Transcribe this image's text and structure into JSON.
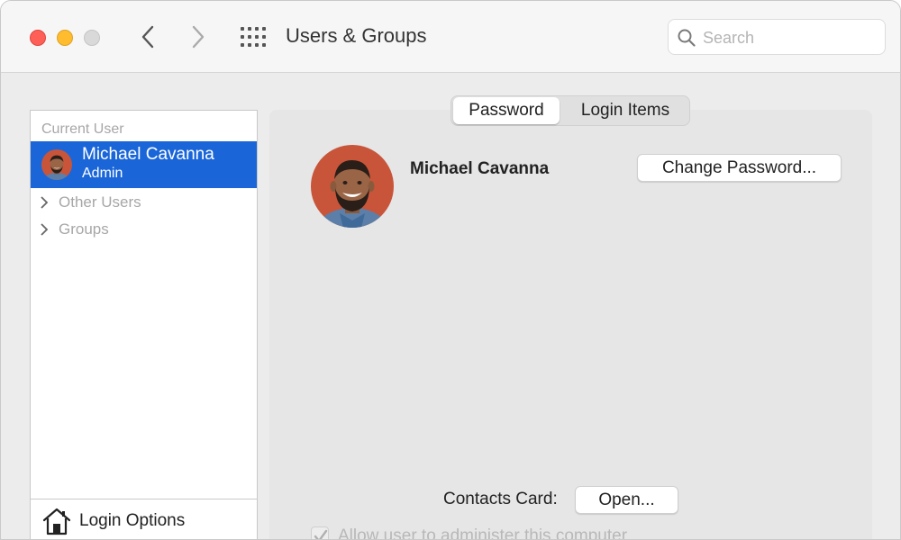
{
  "window": {
    "title": "Users & Groups"
  },
  "toolbar": {
    "search": {
      "placeholder": "Search",
      "value": ""
    },
    "icons": [
      "close-button",
      "minimize-button",
      "zoom-button",
      "back-chevron-icon",
      "forward-chevron-icon",
      "grid-icon",
      "search-icon"
    ]
  },
  "sidebar": {
    "section_label": "Current User",
    "current_user": {
      "name": "Michael Cavanna",
      "role": "Admin"
    },
    "groups": [
      {
        "label": "Other Users"
      },
      {
        "label": "Groups"
      }
    ],
    "login_options_label": "Login Options"
  },
  "tabs": [
    {
      "label": "Password",
      "selected": true
    },
    {
      "label": "Login Items",
      "selected": false
    }
  ],
  "main": {
    "user_name": "Michael Cavanna",
    "change_password_label": "Change Password...",
    "contacts_card_label": "Contacts Card:",
    "open_button_label": "Open...",
    "allow_admin_label": "Allow user to administer this computer",
    "allow_admin_checked": true
  },
  "colors": {
    "selection": "#1a66d9",
    "close": "#fe5f57",
    "minimize": "#febc2e",
    "zoom_disabled": "#d9d9d9",
    "avatar_background": "#c8553a"
  }
}
